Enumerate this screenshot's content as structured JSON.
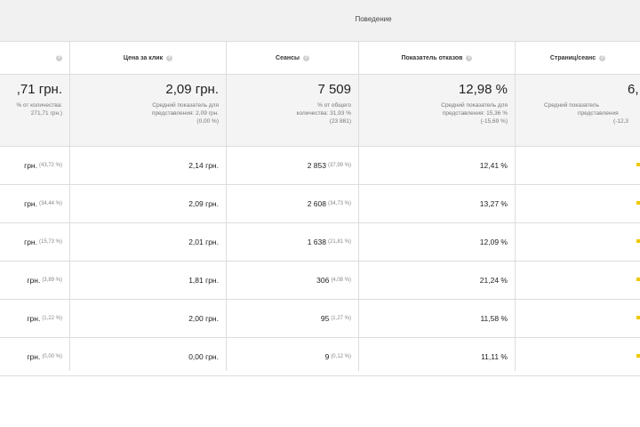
{
  "group_title": "Поведение",
  "columns": {
    "cost_per_click": "Цена за клик",
    "sessions": "Сеансы",
    "bounce_rate": "Показатель отказов",
    "pages_per_session": "Страниц/сеанс"
  },
  "summary": {
    "col0": {
      "value": ",71 грн.",
      "note1": "% от количества:",
      "note2": "271,71 грн.)"
    },
    "cost_per_click": {
      "value": "2,09 грн.",
      "note1": "Средний показатель для",
      "note2": "представления: 2,09 грн.",
      "note3": "(0,00 %)"
    },
    "sessions": {
      "value": "7 509",
      "note1": "% от общего",
      "note2": "количества: 31,93 %",
      "note3": "(23 881)"
    },
    "bounce_rate": {
      "value": "12,98 %",
      "note1": "Средний показатель для",
      "note2": "представления: 15,36 %",
      "note3": "(-15,69 %)"
    },
    "pages_per_session": {
      "value": "6,",
      "note1": "Средний показатель",
      "note2": "представления",
      "note3": "(-12,3"
    }
  },
  "rows": [
    {
      "col0": "грн.",
      "col0_pct": "(43,72 %)",
      "cpc": "2,14 грн.",
      "sessions": "2 853",
      "sessions_pct": "(37,99 %)",
      "bounce": "12,41 %"
    },
    {
      "col0": "грн.",
      "col0_pct": "(34,44 %)",
      "cpc": "2,09 грн.",
      "sessions": "2 608",
      "sessions_pct": "(34,73 %)",
      "bounce": "13,27 %"
    },
    {
      "col0": "грн.",
      "col0_pct": "(15,73 %)",
      "cpc": "2,01 грн.",
      "sessions": "1 638",
      "sessions_pct": "(21,81 %)",
      "bounce": "12,09 %"
    },
    {
      "col0": "грн.",
      "col0_pct": "(3,89 %)",
      "cpc": "1,81 грн.",
      "sessions": "306",
      "sessions_pct": "(4,08 %)",
      "bounce": "21,24 %"
    },
    {
      "col0": "грн.",
      "col0_pct": "(1,22 %)",
      "cpc": "2,00 грн.",
      "sessions": "95",
      "sessions_pct": "(1,27 %)",
      "bounce": "11,58 %"
    },
    {
      "col0": "грн.",
      "col0_pct": "(0,00 %)",
      "cpc": "0,00 грн.",
      "sessions": "9",
      "sessions_pct": "(0,12 %)",
      "bounce": "11,11 %"
    }
  ],
  "icons": {
    "help": "question-circle-icon"
  },
  "colors": {
    "header_bg": "#f1f1f1",
    "summary_bg": "#f4f4f4",
    "border": "#dddddd",
    "accent_yellow": "#f0c800"
  }
}
